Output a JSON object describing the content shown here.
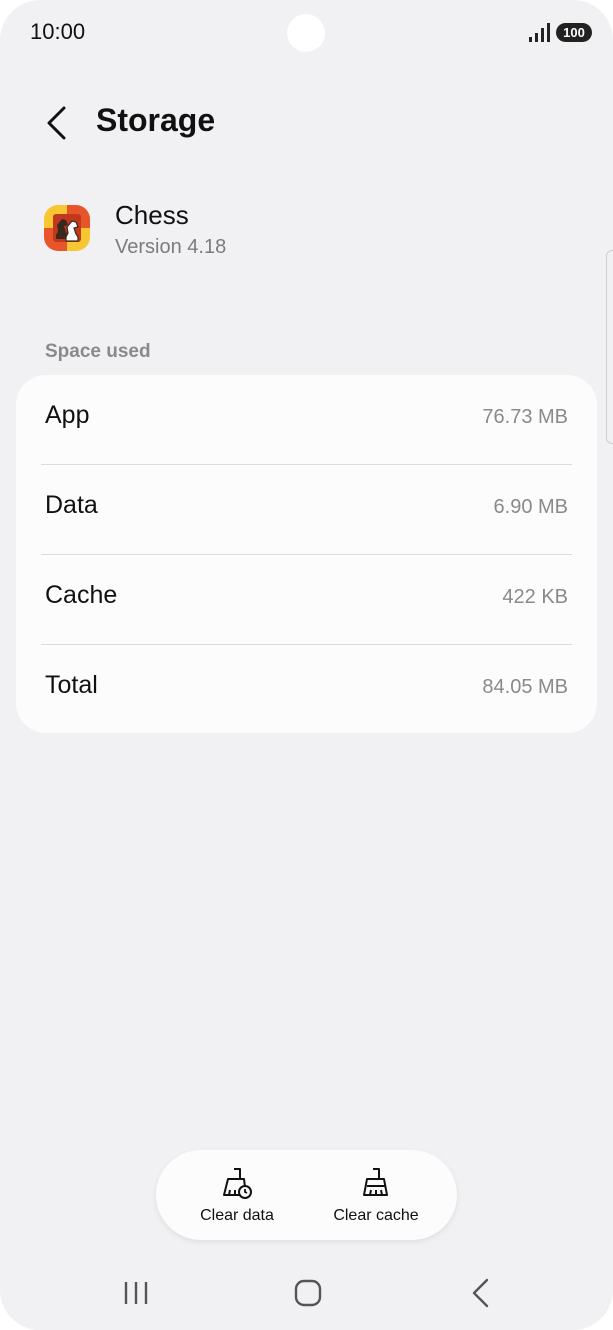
{
  "status_bar": {
    "time": "10:00",
    "battery": "100"
  },
  "header": {
    "title": "Storage"
  },
  "app": {
    "name": "Chess",
    "version": "Version 4.18"
  },
  "space_used": {
    "label": "Space used",
    "rows": [
      {
        "label": "App",
        "value": "76.73 MB"
      },
      {
        "label": "Data",
        "value": "6.90 MB"
      },
      {
        "label": "Cache",
        "value": "422 KB"
      },
      {
        "label": "Total",
        "value": "84.05 MB"
      }
    ]
  },
  "actions": {
    "clear_data": "Clear data",
    "clear_cache": "Clear cache"
  },
  "icons": {
    "back": "chevron-left-icon",
    "app": "chess-app-icon",
    "clear_data": "broom-clock-icon",
    "clear_cache": "broom-icon"
  }
}
